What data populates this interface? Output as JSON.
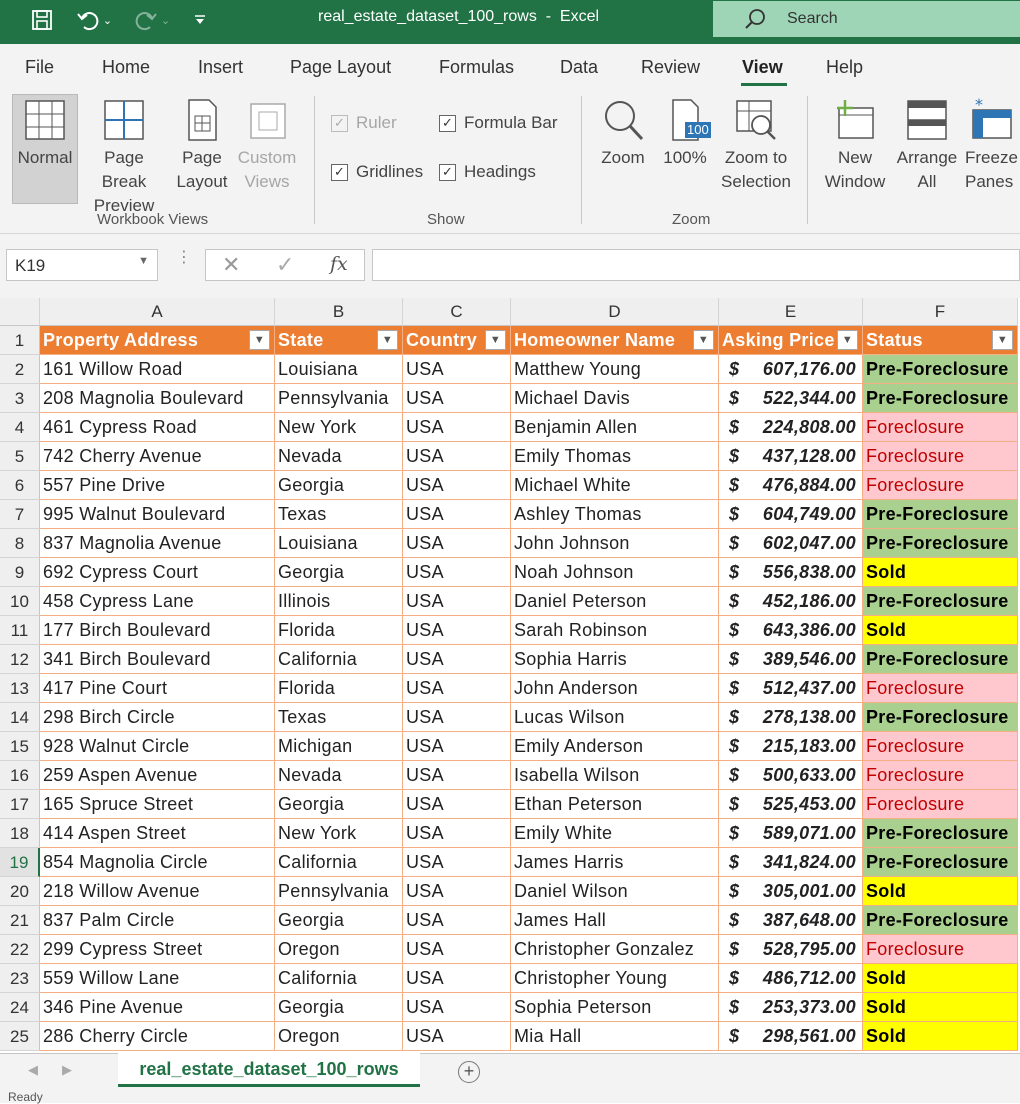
{
  "window": {
    "title": "real_estate_dataset_100_rows  -  Excel"
  },
  "qat": {
    "save_icon": "save-icon",
    "undo_icon": "undo-icon",
    "redo_icon": "redo-icon",
    "customize_icon": "customize-icon"
  },
  "search": {
    "label": "Search"
  },
  "menu": {
    "items": [
      "File",
      "Home",
      "Insert",
      "Page Layout",
      "Formulas",
      "Data",
      "Review",
      "View",
      "Help"
    ],
    "active": "View"
  },
  "ribbon": {
    "workbook_views": {
      "label": "Workbook Views",
      "normal": "Normal",
      "page_break_1": "Page Break",
      "page_break_2": "Preview",
      "page_layout_1": "Page",
      "page_layout_2": "Layout",
      "custom_1": "Custom",
      "custom_2": "Views"
    },
    "show": {
      "label": "Show",
      "ruler": "Ruler",
      "formula_bar": "Formula Bar",
      "gridlines": "Gridlines",
      "headings": "Headings"
    },
    "zoom": {
      "label": "Zoom",
      "zoom": "Zoom",
      "hundred": "100%",
      "badge": "100",
      "zoom_sel_1": "Zoom to",
      "zoom_sel_2": "Selection"
    },
    "window": {
      "new_1": "New",
      "new_2": "Window",
      "arrange_1": "Arrange",
      "arrange_2": "All",
      "freeze_1": "Freeze",
      "freeze_2": "Panes"
    }
  },
  "formula_bar": {
    "name_box": "K19",
    "fx": "fx",
    "value": ""
  },
  "grid": {
    "columns": [
      "A",
      "B",
      "C",
      "D",
      "E",
      "F"
    ],
    "headers": [
      "Property Address",
      "State",
      "Country",
      "Homeowner Name",
      "Asking Price",
      "Status"
    ],
    "selected_row": 19,
    "rows": [
      {
        "n": 2,
        "address": "161 Willow Road",
        "state": "Louisiana",
        "country": "USA",
        "owner": "Matthew Young",
        "price": "607,176.00",
        "status": "Pre-Foreclosure"
      },
      {
        "n": 3,
        "address": "208 Magnolia Boulevard",
        "state": "Pennsylvania",
        "country": "USA",
        "owner": "Michael Davis",
        "price": "522,344.00",
        "status": "Pre-Foreclosure"
      },
      {
        "n": 4,
        "address": "461 Cypress Road",
        "state": "New York",
        "country": "USA",
        "owner": "Benjamin Allen",
        "price": "224,808.00",
        "status": "Foreclosure"
      },
      {
        "n": 5,
        "address": "742 Cherry Avenue",
        "state": "Nevada",
        "country": "USA",
        "owner": "Emily Thomas",
        "price": "437,128.00",
        "status": "Foreclosure"
      },
      {
        "n": 6,
        "address": "557 Pine Drive",
        "state": "Georgia",
        "country": "USA",
        "owner": "Michael White",
        "price": "476,884.00",
        "status": "Foreclosure"
      },
      {
        "n": 7,
        "address": "995 Walnut Boulevard",
        "state": "Texas",
        "country": "USA",
        "owner": "Ashley Thomas",
        "price": "604,749.00",
        "status": "Pre-Foreclosure"
      },
      {
        "n": 8,
        "address": "837 Magnolia Avenue",
        "state": "Louisiana",
        "country": "USA",
        "owner": "John Johnson",
        "price": "602,047.00",
        "status": "Pre-Foreclosure"
      },
      {
        "n": 9,
        "address": "692 Cypress Court",
        "state": "Georgia",
        "country": "USA",
        "owner": "Noah Johnson",
        "price": "556,838.00",
        "status": "Sold"
      },
      {
        "n": 10,
        "address": "458 Cypress Lane",
        "state": "Illinois",
        "country": "USA",
        "owner": "Daniel Peterson",
        "price": "452,186.00",
        "status": "Pre-Foreclosure"
      },
      {
        "n": 11,
        "address": "177 Birch Boulevard",
        "state": "Florida",
        "country": "USA",
        "owner": "Sarah Robinson",
        "price": "643,386.00",
        "status": "Sold"
      },
      {
        "n": 12,
        "address": "341 Birch Boulevard",
        "state": "California",
        "country": "USA",
        "owner": "Sophia Harris",
        "price": "389,546.00",
        "status": "Pre-Foreclosure"
      },
      {
        "n": 13,
        "address": "417 Pine Court",
        "state": "Florida",
        "country": "USA",
        "owner": "John Anderson",
        "price": "512,437.00",
        "status": "Foreclosure"
      },
      {
        "n": 14,
        "address": "298 Birch Circle",
        "state": "Texas",
        "country": "USA",
        "owner": "Lucas Wilson",
        "price": "278,138.00",
        "status": "Pre-Foreclosure"
      },
      {
        "n": 15,
        "address": "928 Walnut Circle",
        "state": "Michigan",
        "country": "USA",
        "owner": "Emily Anderson",
        "price": "215,183.00",
        "status": "Foreclosure"
      },
      {
        "n": 16,
        "address": "259 Aspen Avenue",
        "state": "Nevada",
        "country": "USA",
        "owner": "Isabella Wilson",
        "price": "500,633.00",
        "status": "Foreclosure"
      },
      {
        "n": 17,
        "address": "165 Spruce Street",
        "state": "Georgia",
        "country": "USA",
        "owner": "Ethan Peterson",
        "price": "525,453.00",
        "status": "Foreclosure"
      },
      {
        "n": 18,
        "address": "414 Aspen Street",
        "state": "New York",
        "country": "USA",
        "owner": "Emily White",
        "price": "589,071.00",
        "status": "Pre-Foreclosure"
      },
      {
        "n": 19,
        "address": "854 Magnolia Circle",
        "state": "California",
        "country": "USA",
        "owner": "James Harris",
        "price": "341,824.00",
        "status": "Pre-Foreclosure"
      },
      {
        "n": 20,
        "address": "218 Willow Avenue",
        "state": "Pennsylvania",
        "country": "USA",
        "owner": "Daniel Wilson",
        "price": "305,001.00",
        "status": "Sold"
      },
      {
        "n": 21,
        "address": "837 Palm Circle",
        "state": "Georgia",
        "country": "USA",
        "owner": "James Hall",
        "price": "387,648.00",
        "status": "Pre-Foreclosure"
      },
      {
        "n": 22,
        "address": "299 Cypress Street",
        "state": "Oregon",
        "country": "USA",
        "owner": "Christopher Gonzalez",
        "price": "528,795.00",
        "status": "Foreclosure"
      },
      {
        "n": 23,
        "address": "559 Willow Lane",
        "state": "California",
        "country": "USA",
        "owner": "Christopher Young",
        "price": "486,712.00",
        "status": "Sold"
      },
      {
        "n": 24,
        "address": "346 Pine Avenue",
        "state": "Georgia",
        "country": "USA",
        "owner": "Sophia Peterson",
        "price": "253,373.00",
        "status": "Sold"
      },
      {
        "n": 25,
        "address": "286 Cherry Circle",
        "state": "Oregon",
        "country": "USA",
        "owner": "Mia Hall",
        "price": "298,561.00",
        "status": "Sold"
      }
    ],
    "currency": "$"
  },
  "sheets": {
    "active": "real_estate_dataset_100_rows",
    "add_icon": "plus-circle-icon"
  },
  "status": {
    "text": "Ready"
  },
  "colors": {
    "accent": "#217346",
    "header_fill": "#ed7d31",
    "pre": "#a9d08e",
    "fore_fill": "#ffc7ce",
    "fore_text": "#c00000",
    "sold": "#ffff00"
  }
}
